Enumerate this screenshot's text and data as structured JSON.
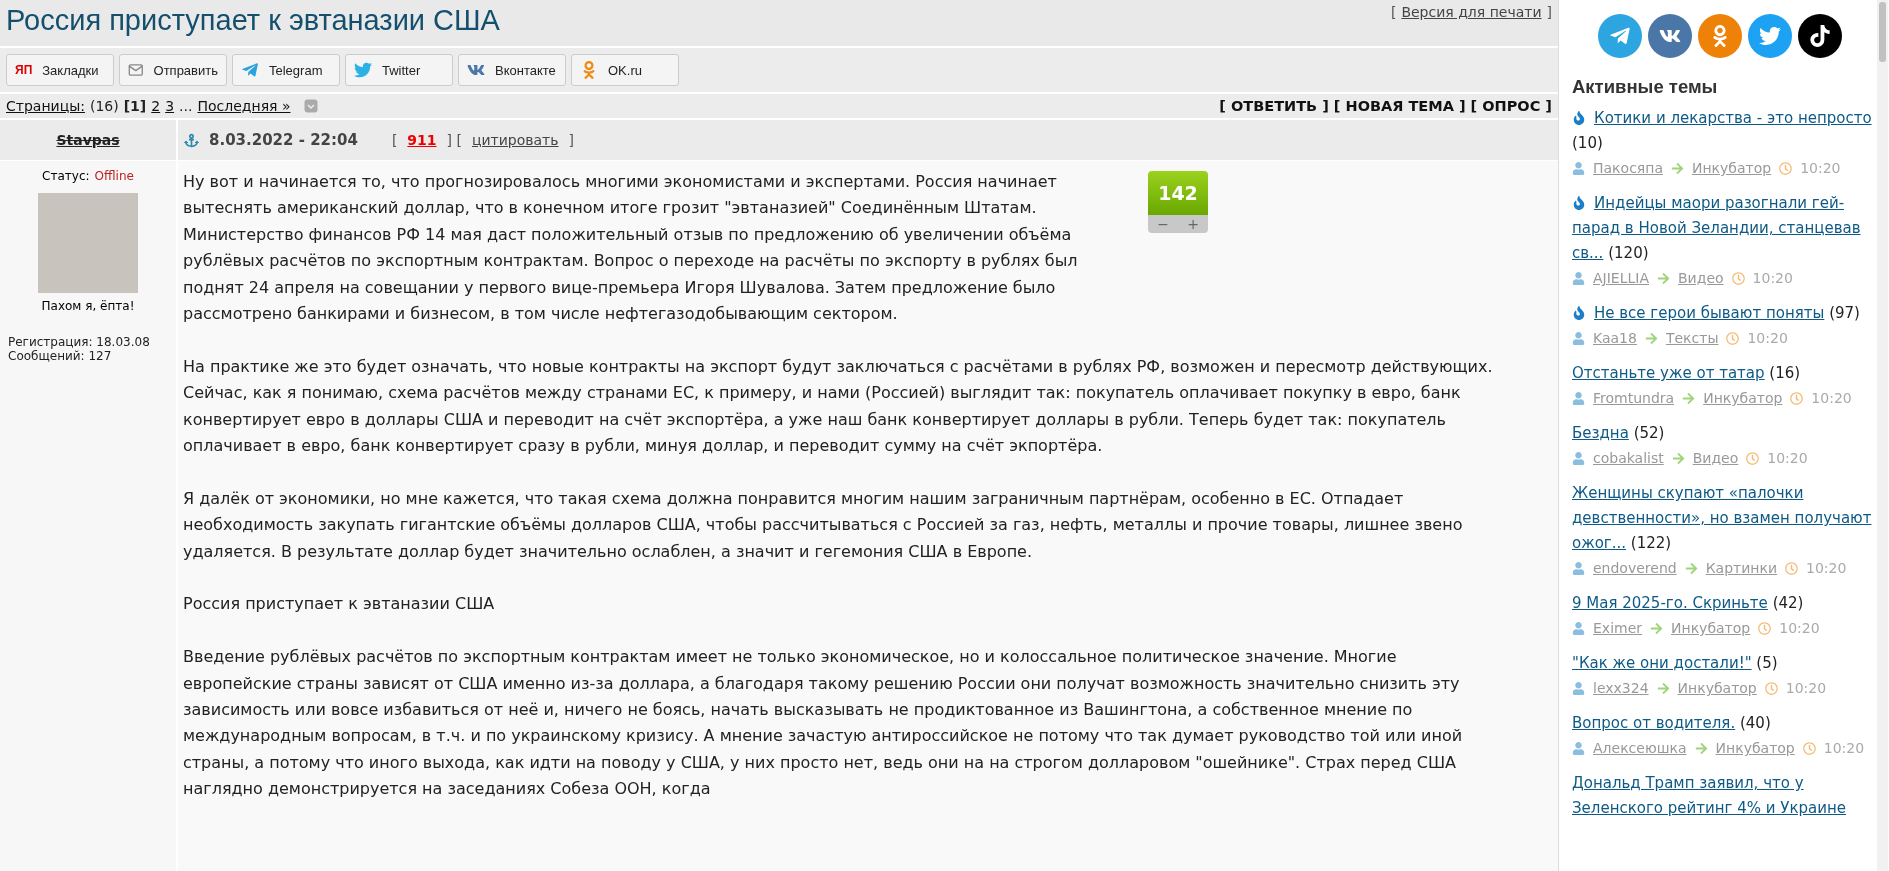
{
  "topic": {
    "title": "Россия приступает к эвтаназии США",
    "print_link": "Версия для печати",
    "brackets": [
      "[",
      "]"
    ]
  },
  "share_buttons": [
    {
      "kind": "yandex",
      "icon_text": "ЯП",
      "label": "Закладки"
    },
    {
      "kind": "mail",
      "label": "Отправить"
    },
    {
      "kind": "telegram",
      "label": "Telegram"
    },
    {
      "kind": "twitter",
      "label": "Twitter"
    },
    {
      "kind": "vk",
      "label": "Вконтакте"
    },
    {
      "kind": "ok",
      "label": "OK.ru"
    }
  ],
  "pager": {
    "label": "Страницы:",
    "count": "(16)",
    "pages": [
      {
        "label": "[1]",
        "selected": true
      },
      {
        "label": "2",
        "selected": false
      },
      {
        "label": "3",
        "selected": false
      }
    ],
    "ellipsis": "...",
    "last": "Последняя »"
  },
  "actions": [
    "[ ОТВЕТИТЬ ]",
    "[ НОВАЯ ТЕМА ]",
    "[ ОПРОС ]"
  ],
  "post": {
    "author": "Stavpas",
    "author_banned": true,
    "status_label": "Статус:",
    "status": "Offline",
    "online": false,
    "avatar_caption": "Пахом я, ёпта!",
    "registered": "Регистрация: 18.03.08",
    "messages": "Сообщений: 127",
    "date": "8.03.2022 - 22:04",
    "number": "911",
    "quote": "цитировать",
    "header_brackets": [
      "[",
      "] [",
      "]"
    ],
    "rating": {
      "value": "142",
      "minus": "−",
      "plus": "+"
    },
    "paragraphs": [
      "Ну вот и начинается то, что прогнозировалось многими экономистами и экспертами. Россия начинает вытеснять американский доллар, что в конечном итоге грозит \"эвтаназией\" Соединённым Штатам. Министерство финансов РФ 14 мая даст положительный отзыв по предложению об увеличении объёма рублёвых расчётов по экспортным контрактам. Вопрос о переходе на расчёты по экспорту в рублях был поднят 24 апреля на совещании у первого вице-премьера Игоря Шувалова. Затем предложение было рассмотрено банкирами и бизнесом, в том числе нефтегазодобывающим сектором.",
      "На практике же это будет означать, что новые контракты на экспорт будут заключаться с расчётами в рублях РФ, возможен и пересмотр действующих. Сейчас, как я понимаю, схема расчётов между странами ЕС, к примеру, и нами (Россией) выглядит так: покупатель оплачивает покупку в евро, банк конвертирует евро в доллары США и переводит на счёт экспортёра, а уже наш банк конвертирует доллары в рубли. Теперь будет так: покупатель оплачивает в евро, банк конвертирует сразу в рубли, минуя доллар, и переводит сумму на счёт экпортёра.",
      "Я далёк от экономики, но мне кажется, что такая схема должна понравится многим нашим заграничным партнёрам, особенно в ЕС. Отпадает необходимость закупать гигантские объёмы долларов США, чтобы рассчитываться с Россией за газ, нефть, металлы и прочие товары, лишнее звено удаляется. В результате доллар будет значительно ослаблен, а значит и гегемония США в Европе.",
      "Россия приступает к эвтаназии США",
      "Введение рублёвых расчётов по экспортным контрактам имеет не только экономическое, но и колоссальное политическое значение. Многие европейские страны зависят от США именно из-за доллара, а благодаря такому решению России они получат возможность значительно снизить эту зависимость или вовсе избавиться от неё и, ничего не боясь, начать высказывать не продиктованное из Вашингтона, а собственное мнение по международным вопросам, в т.ч. и по украинскому кризису. А мнение зачастую антироссийское не потому что так думает руководство той или иной страны, а потому что иного выхода, как идти на поводу у США, у них просто нет, ведь они на на строгом долларовом \"ошейнике\". Страх перед США наглядно демонстрируется на заседаниях Собеза ООН, когда"
    ]
  },
  "social": [
    {
      "kind": "telegram"
    },
    {
      "kind": "vk"
    },
    {
      "kind": "ok"
    },
    {
      "kind": "twitter"
    },
    {
      "kind": "tiktok"
    }
  ],
  "active_topics": {
    "heading": "Активные темы",
    "items": [
      {
        "hot": true,
        "title": "Котики и лекарства - это непросто",
        "count": "(10)",
        "author": "Пакосяпа",
        "section": "Инкубатор",
        "time": "10:20"
      },
      {
        "hot": true,
        "title": "Индейцы маори разогнали гей-парад в Новой Зеландии, станцевав св...",
        "count": "(120)",
        "author": "AJIELLIA",
        "section": "Видео",
        "time": "10:20"
      },
      {
        "hot": true,
        "title": "Не все герои бывают поняты",
        "count": "(97)",
        "author": "Kaa18",
        "section": "Тексты",
        "time": "10:20"
      },
      {
        "hot": false,
        "title": "Отстаньте уже от татар",
        "count": "(16)",
        "author": "Fromtundra",
        "section": "Инкубатор",
        "time": "10:20"
      },
      {
        "hot": false,
        "title": "Бездна",
        "count": "(52)",
        "author": "cobakalist",
        "section": "Видео",
        "time": "10:20"
      },
      {
        "hot": false,
        "title": "Женщины скупают «палочки девственности», но взамен получают ожог...",
        "count": "(122)",
        "author": "endoverend",
        "section": "Картинки",
        "time": "10:20"
      },
      {
        "hot": false,
        "title": "9 Мая 2025-го. Скриньте",
        "count": "(42)",
        "author": "Eximer",
        "section": "Инкубатор",
        "time": "10:20"
      },
      {
        "hot": false,
        "title": "\"Как же они достали!\"",
        "count": "(5)",
        "author": "lexx324",
        "section": "Инкубатор",
        "time": "10:20"
      },
      {
        "hot": false,
        "title": "Вопрос от водителя.",
        "count": "(40)",
        "author": "Алексеюшка",
        "section": "Инкубатор",
        "time": "10:20"
      },
      {
        "hot": false,
        "title": "Дональд Трамп заявил, что у Зеленского рейтинг 4% и Украине"
      }
    ]
  }
}
